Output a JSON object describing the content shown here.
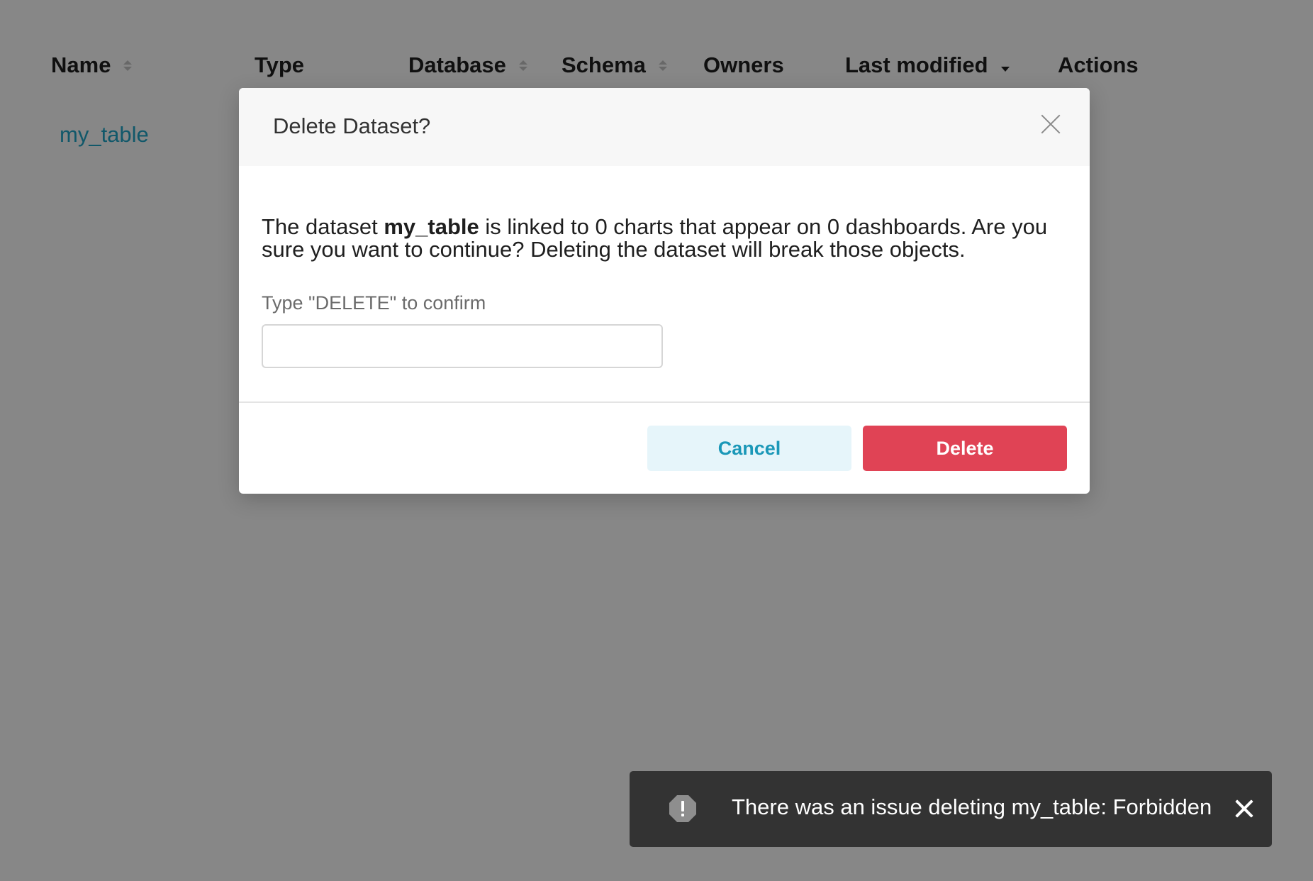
{
  "table": {
    "columns": [
      {
        "label": "Name",
        "sort": "both"
      },
      {
        "label": "Type",
        "sort": "none"
      },
      {
        "label": "Database",
        "sort": "both"
      },
      {
        "label": "Schema",
        "sort": "both"
      },
      {
        "label": "Owners",
        "sort": "none"
      },
      {
        "label": "Last modified",
        "sort": "desc"
      },
      {
        "label": "Actions",
        "sort": "none"
      }
    ],
    "rows": [
      {
        "name": "my_table"
      }
    ]
  },
  "modal": {
    "title": "Delete Dataset?",
    "body_prefix": "The dataset ",
    "dataset_name": "my_table",
    "body_suffix": " is linked to 0 charts that appear on 0 dashboards. Are you sure you want to continue? Deleting the dataset will break those objects.",
    "confirm_label": "Type \"DELETE\" to confirm",
    "confirm_value": "",
    "cancel_label": "Cancel",
    "delete_label": "Delete"
  },
  "toast": {
    "message": "There was an issue deleting my_table: Forbidden",
    "icon": "warning-octagon-icon"
  },
  "colors": {
    "link": "#20a7c9",
    "danger": "#e04355",
    "cancel_bg": "#e6f5fa",
    "toast_bg": "#333333"
  }
}
